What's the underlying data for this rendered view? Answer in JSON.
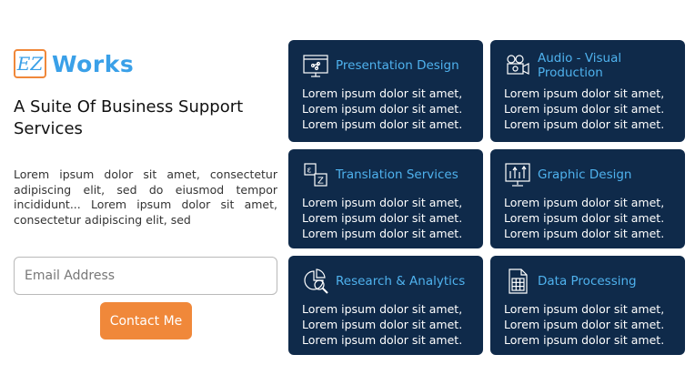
{
  "brand": {
    "logo_mark": "EZ",
    "name": "Works"
  },
  "tagline": "A Suite Of Business Support Services",
  "intro": "Lorem ipsum dolor sit amet, consectetur adipiscing elit, sed do eiusmod tempor incididunt... Lorem ipsum dolor sit amet, consectetur adipiscing elit, sed",
  "form": {
    "email_placeholder": "Email Address",
    "contact_label": "Contact Me"
  },
  "services": [
    {
      "title": "Presentation Design",
      "icon": "presentation-icon",
      "lines": [
        "Lorem ipsum dolor sit amet,",
        "Lorem ipsum dolor sit amet.",
        "Lorem ipsum dolor sit amet."
      ]
    },
    {
      "title": "Audio - Visual Production",
      "icon": "video-camera-icon",
      "lines": [
        "Lorem ipsum dolor sit amet,",
        "Lorem ipsum dolor sit amet.",
        "Lorem ipsum dolor sit amet."
      ]
    },
    {
      "title": "Translation Services",
      "icon": "translation-icon",
      "lines": [
        "Lorem ipsum dolor sit amet,",
        "Lorem ipsum dolor sit amet.",
        "Lorem ipsum dolor sit amet."
      ]
    },
    {
      "title": "Graphic Design",
      "icon": "graphic-design-icon",
      "lines": [
        "Lorem ipsum dolor sit amet,",
        "Lorem ipsum dolor sit amet.",
        "Lorem ipsum dolor sit amet."
      ]
    },
    {
      "title": "Research & Analytics",
      "icon": "research-analytics-icon",
      "lines": [
        "Lorem ipsum dolor sit amet,",
        "Lorem ipsum dolor sit amet.",
        "Lorem ipsum dolor sit amet."
      ]
    },
    {
      "title": "Data Processing",
      "icon": "data-processing-icon",
      "lines": [
        "Lorem ipsum dolor sit amet,",
        "Lorem ipsum dolor sit amet.",
        "Lorem ipsum dolor sit amet."
      ]
    }
  ],
  "colors": {
    "accent_orange": "#f0883a",
    "brand_blue": "#3aa0e8",
    "card_bg": "#0f2a4a",
    "card_title": "#4fb2ee"
  }
}
